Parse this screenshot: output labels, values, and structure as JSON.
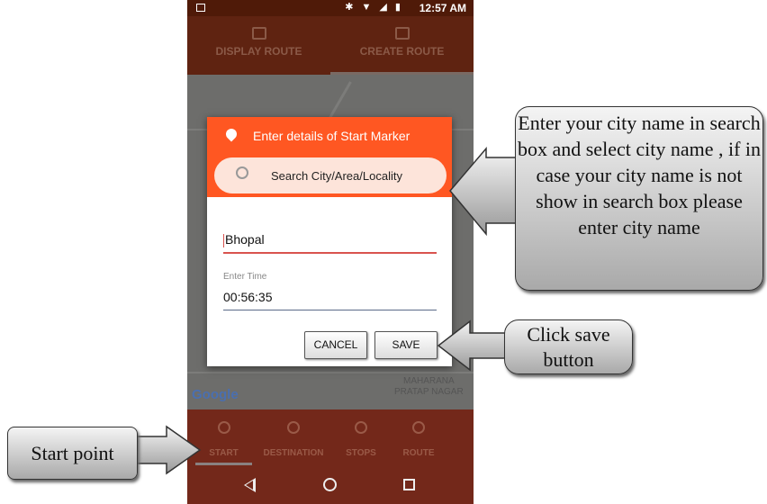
{
  "status_bar": {
    "time": "12:57 AM",
    "icons": "bluetooth wifi signal battery"
  },
  "top_tabs": [
    {
      "label": "DISPLAY ROUTE",
      "icon": "map-frame-icon"
    },
    {
      "label": "CREATE ROUTE",
      "icon": "map-icon",
      "active": true
    }
  ],
  "map": {
    "logo": "Google",
    "place_label": "MAHARANA\nPRATAP NAGAR"
  },
  "dialog": {
    "title": "Enter details of Start Marker",
    "search_placeholder": "Search City/Area/Locality",
    "city_value": "Bhopal",
    "time_label": "Enter Time",
    "time_value": "00:56:35",
    "cancel_label": "CANCEL",
    "save_label": "SAVE",
    "accent": "#ff5722"
  },
  "bottom_tabs": [
    {
      "label": "START",
      "active": true
    },
    {
      "label": "DESTINATION"
    },
    {
      "label": "STOPS"
    },
    {
      "label": "ROUTE"
    }
  ],
  "callouts": {
    "search": "Enter your city name in search box and select city name , if in case your city name is not show in search box please enter city name",
    "save": "Click save button",
    "start": "Start point"
  }
}
